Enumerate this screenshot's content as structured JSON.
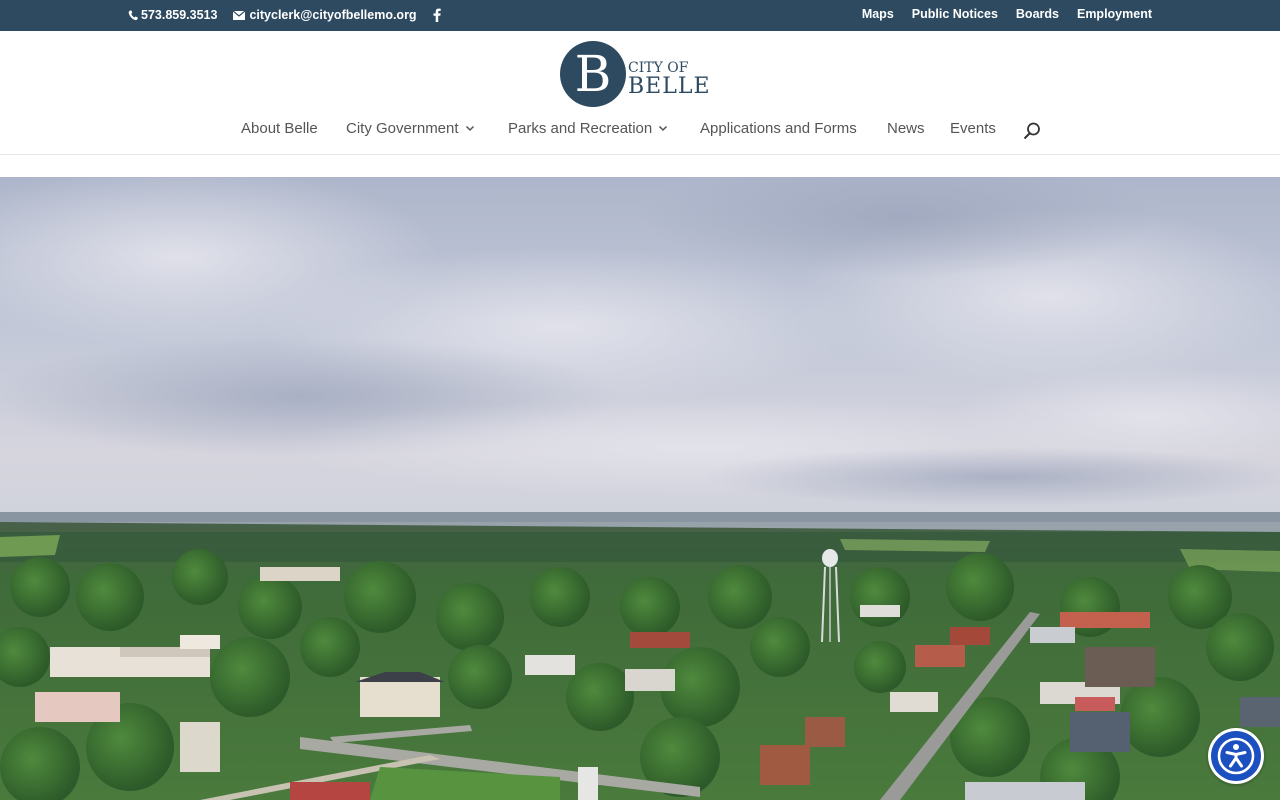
{
  "topbar": {
    "phone": "573.859.3513",
    "email": "cityclerk@cityofbellemo.org",
    "social_icon": "facebook-icon",
    "links": [
      "Maps",
      "Public Notices",
      "Boards",
      "Employment"
    ],
    "background": "#2e4a60"
  },
  "logo": {
    "letter": "B",
    "line1": "CITY OF",
    "line2": "BELLE"
  },
  "nav": {
    "items": [
      {
        "label": "About Belle",
        "has_dropdown": false
      },
      {
        "label": "City Government",
        "has_dropdown": true
      },
      {
        "label": "Parks and Recreation",
        "has_dropdown": true
      },
      {
        "label": "Applications and Forms",
        "has_dropdown": false
      },
      {
        "label": "News",
        "has_dropdown": false
      },
      {
        "label": "Events",
        "has_dropdown": false
      }
    ],
    "search_icon": "search-icon"
  },
  "accessibility": {
    "icon": "accessibility-icon",
    "color": "#1c4fbf"
  }
}
